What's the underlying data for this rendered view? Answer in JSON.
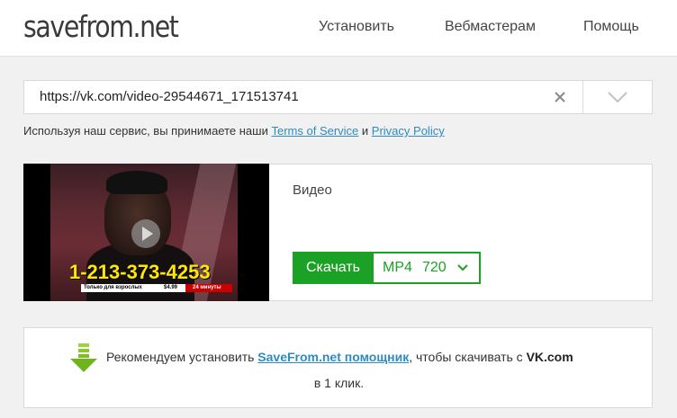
{
  "header": {
    "logo": "savefrom.net",
    "nav": [
      "Установить",
      "Вебмастерам",
      "Помощь"
    ]
  },
  "search": {
    "url": "https://vk.com/video-29544671_171513741"
  },
  "terms": {
    "prefix": "Используя наш сервис, вы принимаете наши ",
    "tos": "Terms of Service",
    "and": " и ",
    "privacy": "Privacy Policy"
  },
  "result": {
    "label": "Видео",
    "thumbnail": {
      "phone": "1-213-373-4253",
      "ticker_left": "Только для взрослых",
      "ticker_price": "$4.99",
      "ticker_right": "24 минуты"
    },
    "download_label": "Скачать",
    "format": "MP4",
    "quality": "720"
  },
  "recommend": {
    "text1": "Рекомендуем установить ",
    "link": "SaveFrom.net помощник",
    "text2": ", чтобы скачивать с ",
    "site": "VK.com",
    "line2": "в 1 клик."
  },
  "colors": {
    "accent": "#1ba125",
    "link": "#2f8bbd",
    "background": "#f1f1f1"
  }
}
